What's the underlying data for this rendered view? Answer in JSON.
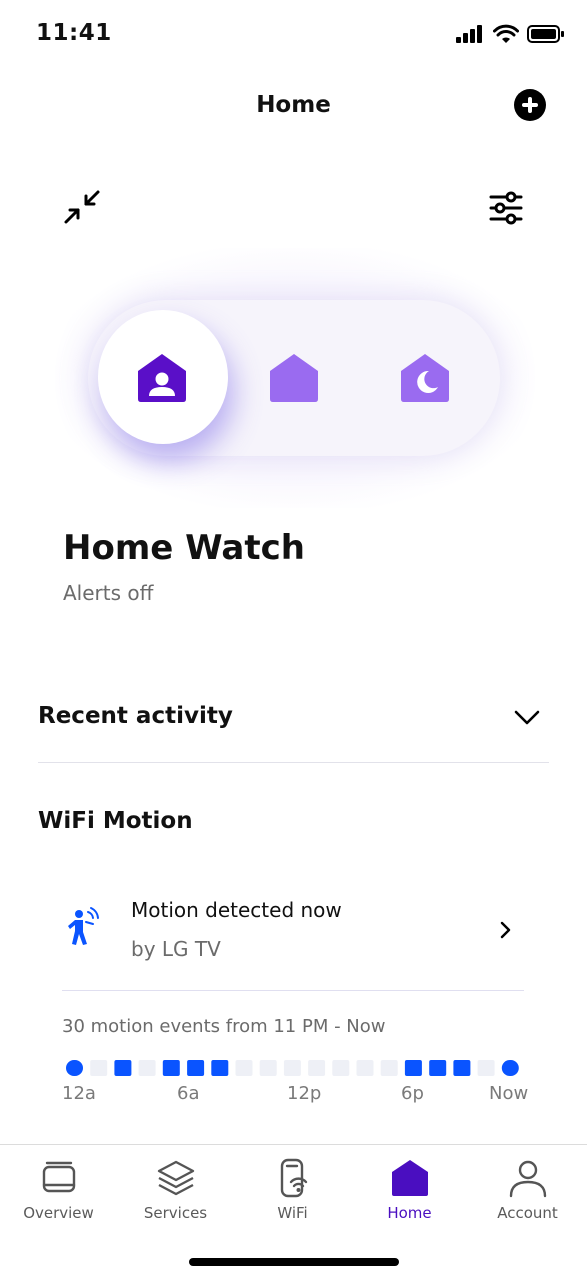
{
  "status_bar": {
    "time": "11:41",
    "icons": [
      "cellular-icon",
      "wifi-icon",
      "battery-icon"
    ]
  },
  "header": {
    "title": "Home",
    "add_icon": "add-icon"
  },
  "toolbar": {
    "collapse_icon": "collapse-arrows-icon",
    "filter_icon": "sliders-icon"
  },
  "mode_selector": {
    "modes": [
      {
        "icon": "home-watch-icon",
        "selected": true
      },
      {
        "icon": "home-icon",
        "selected": false
      },
      {
        "icon": "home-sleep-icon",
        "selected": false
      }
    ],
    "colors": {
      "selected": "#5a0fc8",
      "unselected": "#9a6bf0"
    }
  },
  "mode": {
    "title": "Home Watch",
    "subtitle": "Alerts off"
  },
  "recent_activity": {
    "title": "Recent activity",
    "toggle_icon": "chevron-down-icon"
  },
  "wifi_motion": {
    "title": "WiFi Motion",
    "event": {
      "title": "Motion detected now",
      "source": "by LG TV",
      "icon": "motion-person-icon"
    },
    "summary": "30 motion events from 11 PM - Now",
    "timeline": {
      "labels": [
        "12a",
        "6a",
        "12p",
        "6p",
        "Now"
      ],
      "active_color": "#0a54ff",
      "inactive_color": "#eef0f6",
      "slots": [
        1,
        0,
        1,
        0,
        1,
        1,
        1,
        0,
        0,
        0,
        0,
        0,
        0,
        0,
        1,
        1,
        1,
        0,
        1
      ]
    }
  },
  "bottom_nav": {
    "items": [
      {
        "label": "Overview",
        "icon": "overview-icon",
        "active": false
      },
      {
        "label": "Services",
        "icon": "layers-icon",
        "active": false
      },
      {
        "label": "WiFi",
        "icon": "wifi-pod-icon",
        "active": false
      },
      {
        "label": "Home",
        "icon": "home-icon",
        "active": true
      },
      {
        "label": "Account",
        "icon": "person-icon",
        "active": false
      }
    ],
    "active_color": "#4a0ec0"
  }
}
